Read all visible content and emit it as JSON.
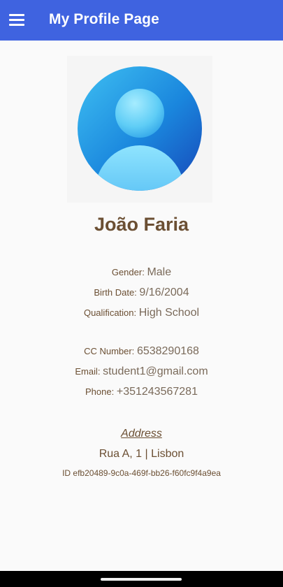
{
  "appbar": {
    "title": "My Profile Page",
    "menu_icon": "hamburger-menu-icon",
    "color": "#3f63e0"
  },
  "profile": {
    "avatar_icon": "user-avatar-icon",
    "name": "João Faria",
    "gender_label": "Gender:",
    "gender": "Male",
    "birth_label": "Birth Date:",
    "birth_date": "9/16/2004",
    "qualification_label": "Qualification:",
    "qualification": "High School",
    "cc_label": "CC Number:",
    "cc_number": "6538290168",
    "email_label": "Email:",
    "email": "student1@gmail.com",
    "phone_label": "Phone:",
    "phone": "+351243567281",
    "address_title": "Address",
    "address_line": "Rua A, 1  |  Lisbon",
    "id_line": "ID efb20489-9c0a-469f-bb26-f60fc9f4a9ea"
  },
  "colors": {
    "name_text": "#6b4f33",
    "value_text": "#7a6a5a",
    "background": "#fafafa"
  }
}
